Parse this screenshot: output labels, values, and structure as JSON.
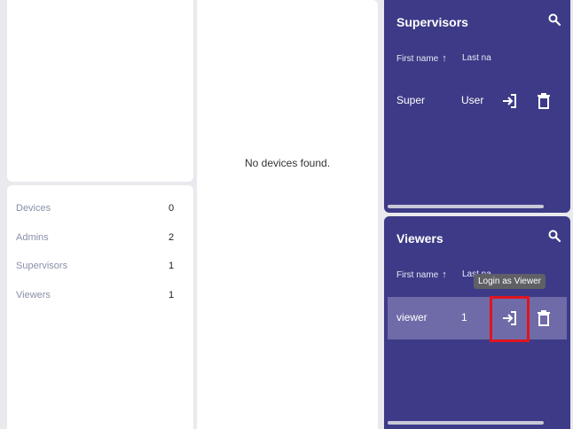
{
  "devices_panel": {
    "empty_message": "No devices found."
  },
  "stats": [
    {
      "label": "Devices",
      "value": "0"
    },
    {
      "label": "Admins",
      "value": "2"
    },
    {
      "label": "Supervisors",
      "value": "1"
    },
    {
      "label": "Viewers",
      "value": "1"
    }
  ],
  "supervisors": {
    "title": "Supervisors",
    "search_icon": "search-icon",
    "columns": {
      "first": "First name",
      "last": "Last na"
    },
    "sort_icon": "↑",
    "rows": [
      {
        "first": "Super",
        "last": "User"
      }
    ]
  },
  "viewers": {
    "title": "Viewers",
    "search_icon": "search-icon",
    "columns": {
      "first": "First name",
      "last": "Last na"
    },
    "sort_icon": "↑",
    "rows": [
      {
        "first": "viewer",
        "last": "1"
      }
    ]
  },
  "tooltip": {
    "text": "Login as Viewer"
  },
  "colors": {
    "panel": "#3d3b87",
    "selected_row": "#6e6ba8",
    "highlight": "#e0141e"
  }
}
